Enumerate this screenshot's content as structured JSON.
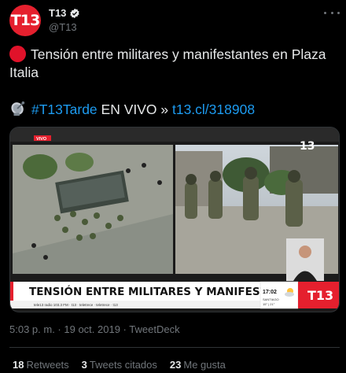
{
  "author": {
    "avatar_text": "T13",
    "display_name": "T13",
    "handle": "@T13",
    "verified": true
  },
  "tweet": {
    "text_line1": "Tensión entre militares y manifestantes en Plaza Italia",
    "hashtag": "#T13Tarde",
    "live_text": " EN VIVO » ",
    "link": "t13.cl/318908"
  },
  "media": {
    "live_badge": "VIVO",
    "headline": "TENSIÓN ENTRE MILITARES Y MANIFESTANTES",
    "ticker": "tele13 radio 103.3 FM   ·   t13   ·   teletrece   ·   teletrece   ·   t13",
    "time": "17:02",
    "city": "SANTIAGO",
    "temp": "15° | 21°",
    "logo_text": "T13",
    "corner_logo": "13"
  },
  "meta": {
    "time": "5:03 p. m.",
    "date": "19 oct. 2019",
    "source": "TweetDeck",
    "separator": " · "
  },
  "stats": {
    "retweets_count": "18",
    "retweets_label": "Retweets",
    "quotes_count": "3",
    "quotes_label": "Tweets citados",
    "likes_count": "23",
    "likes_label": "Me gusta"
  },
  "colors": {
    "brand_red": "#e5202e",
    "link_blue": "#1d9bf0",
    "muted": "#71767b"
  }
}
